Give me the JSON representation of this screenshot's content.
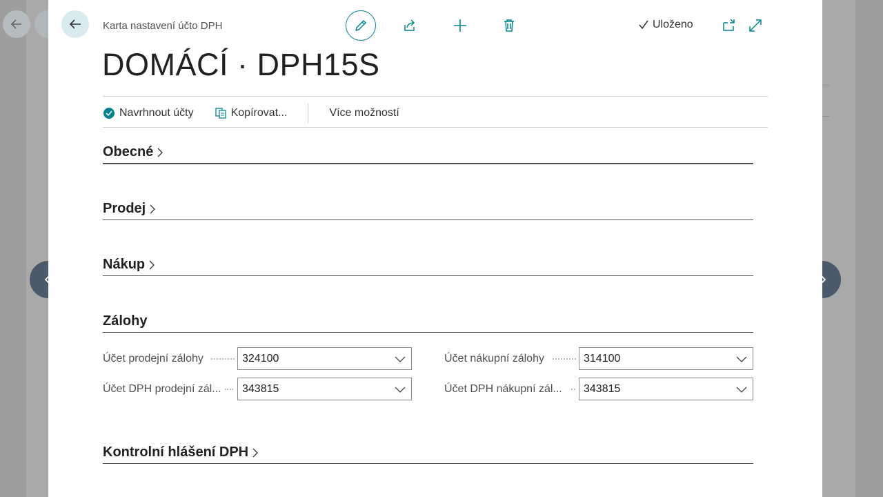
{
  "header": {
    "caption": "Karta nastavení účto DPH",
    "title": "DOMÁCÍ · DPH15S",
    "saved_label": "Uloženo"
  },
  "actions": {
    "suggest": "Navrhnout účty",
    "copy": "Kopírovat...",
    "more": "Více možností"
  },
  "sections": {
    "general": "Obecné",
    "sales": "Prodej",
    "purchase": "Nákup",
    "advances": "Zálohy",
    "control": "Kontrolní hlášení DPH"
  },
  "fields": {
    "sales_advance_label": "Účet prodejní zálohy",
    "sales_advance_value": "324100",
    "sales_vat_label": "Účet DPH prodejní zál...",
    "sales_vat_value": "343815",
    "purchase_advance_label": "Účet nákupní zálohy",
    "purchase_advance_value": "314100",
    "purchase_vat_label": "Účet DPH nákupní zál...",
    "purchase_vat_value": "343815"
  },
  "colors": {
    "accent": "#00838f",
    "nav_button": "#4a5a6a"
  }
}
